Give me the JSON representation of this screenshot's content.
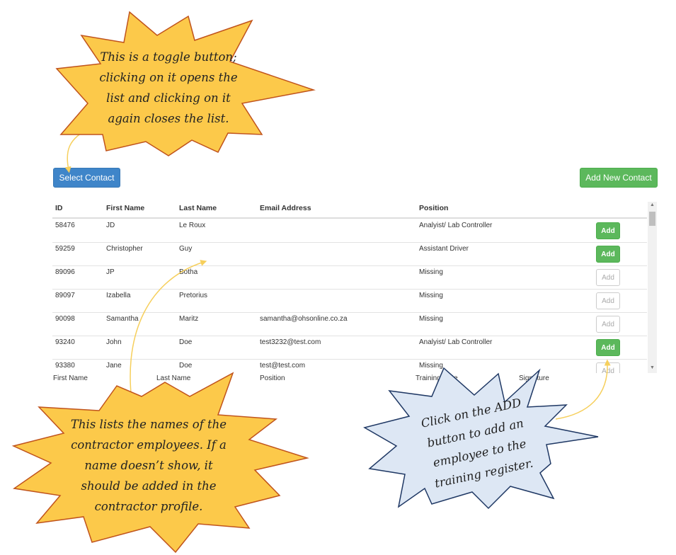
{
  "toolbar": {
    "select_contact_label": "Select Contact",
    "add_new_contact_label": "Add New Contact"
  },
  "table": {
    "headers": [
      "ID",
      "First Name",
      "Last Name",
      "Email Address",
      "Position"
    ],
    "rows": [
      {
        "id": "58476",
        "first": "JD",
        "last": "Le Roux",
        "email": "",
        "position": "Analyist/ Lab Controller",
        "add": "Add",
        "enabled": true
      },
      {
        "id": "59259",
        "first": "Christopher",
        "last": "Guy",
        "email": "",
        "position": "Assistant Driver",
        "add": "Add",
        "enabled": true
      },
      {
        "id": "89096",
        "first": "JP",
        "last": "Botha",
        "email": "",
        "position": "Missing",
        "add": "Add",
        "enabled": false
      },
      {
        "id": "89097",
        "first": "Izabella",
        "last": "Pretorius",
        "email": "",
        "position": "Missing",
        "add": "Add",
        "enabled": false
      },
      {
        "id": "90098",
        "first": "Samantha",
        "last": "Maritz",
        "email": "samantha@ohsonline.co.za",
        "position": "Missing",
        "add": "Add",
        "enabled": false
      },
      {
        "id": "93240",
        "first": "John",
        "last": "Doe",
        "email": "test3232@test.com",
        "position": "Analyist/ Lab Controller",
        "add": "Add",
        "enabled": true
      },
      {
        "id": "93380",
        "first": "Jane",
        "last": "Doe",
        "email": "test@test.com",
        "position": "Missing",
        "add": "Add",
        "enabled": false
      }
    ]
  },
  "register_headers": [
    "First Name",
    "Last Name",
    "Position",
    "Training Date",
    "Signature"
  ],
  "callouts": {
    "toggle": [
      "This is a toggle button;",
      "clicking on it opens the",
      "list and clicking on it",
      "again closes the list."
    ],
    "names": [
      "This lists the names of the",
      "contractor employees. If a",
      "name doesn’t show, it",
      "should be added in the",
      "contractor profile."
    ],
    "add": [
      "Click on the ADD",
      "button to add an",
      "employee to the",
      "training register."
    ]
  },
  "colors": {
    "primary": "#3f85c9",
    "success": "#5cb85c",
    "callout_yellow": "#fcc94a",
    "callout_yellow_stroke": "#c0531c",
    "callout_blue": "#dde7f4",
    "callout_blue_stroke": "#1f3864"
  }
}
